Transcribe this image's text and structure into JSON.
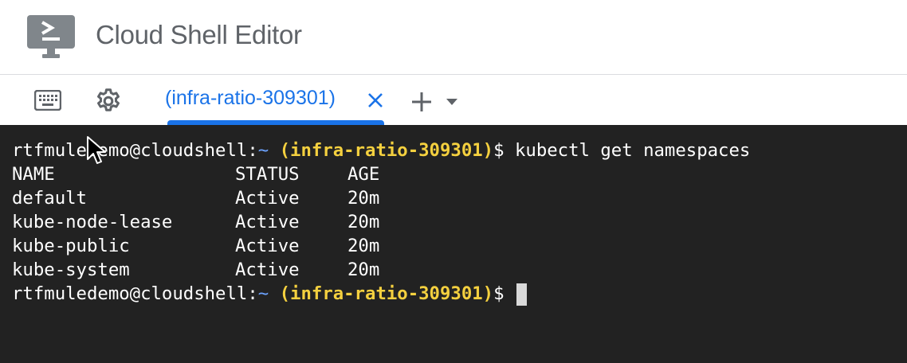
{
  "header": {
    "title": "Cloud Shell Editor",
    "logo_icon": "cloud-shell-terminal-icon"
  },
  "tabbar": {
    "keyboard_icon": "keyboard-icon",
    "settings_icon": "gear-icon",
    "tabs": [
      {
        "label": "(infra-ratio-309301)",
        "active": true
      }
    ],
    "add_tab_icon": "plus-icon",
    "dropdown_icon": "caret-down-icon"
  },
  "terminal": {
    "prompt": {
      "user_host": "rtfmuledemo@cloudshell:",
      "tilde": "~",
      "project": "(infra-ratio-309301)",
      "dollar": "$"
    },
    "command": "kubectl get namespaces",
    "table": {
      "headers": [
        "NAME",
        "STATUS",
        "AGE"
      ],
      "rows": [
        [
          "default",
          "Active",
          "20m"
        ],
        [
          "kube-node-lease",
          "Active",
          "20m"
        ],
        [
          "kube-public",
          "Active",
          "20m"
        ],
        [
          "kube-system",
          "Active",
          "20m"
        ]
      ]
    }
  },
  "colors": {
    "accent": "#1a73e8",
    "terminal_bg": "#222222",
    "prompt_tilde": "#6ca3ff",
    "prompt_project": "#f4d03f"
  }
}
